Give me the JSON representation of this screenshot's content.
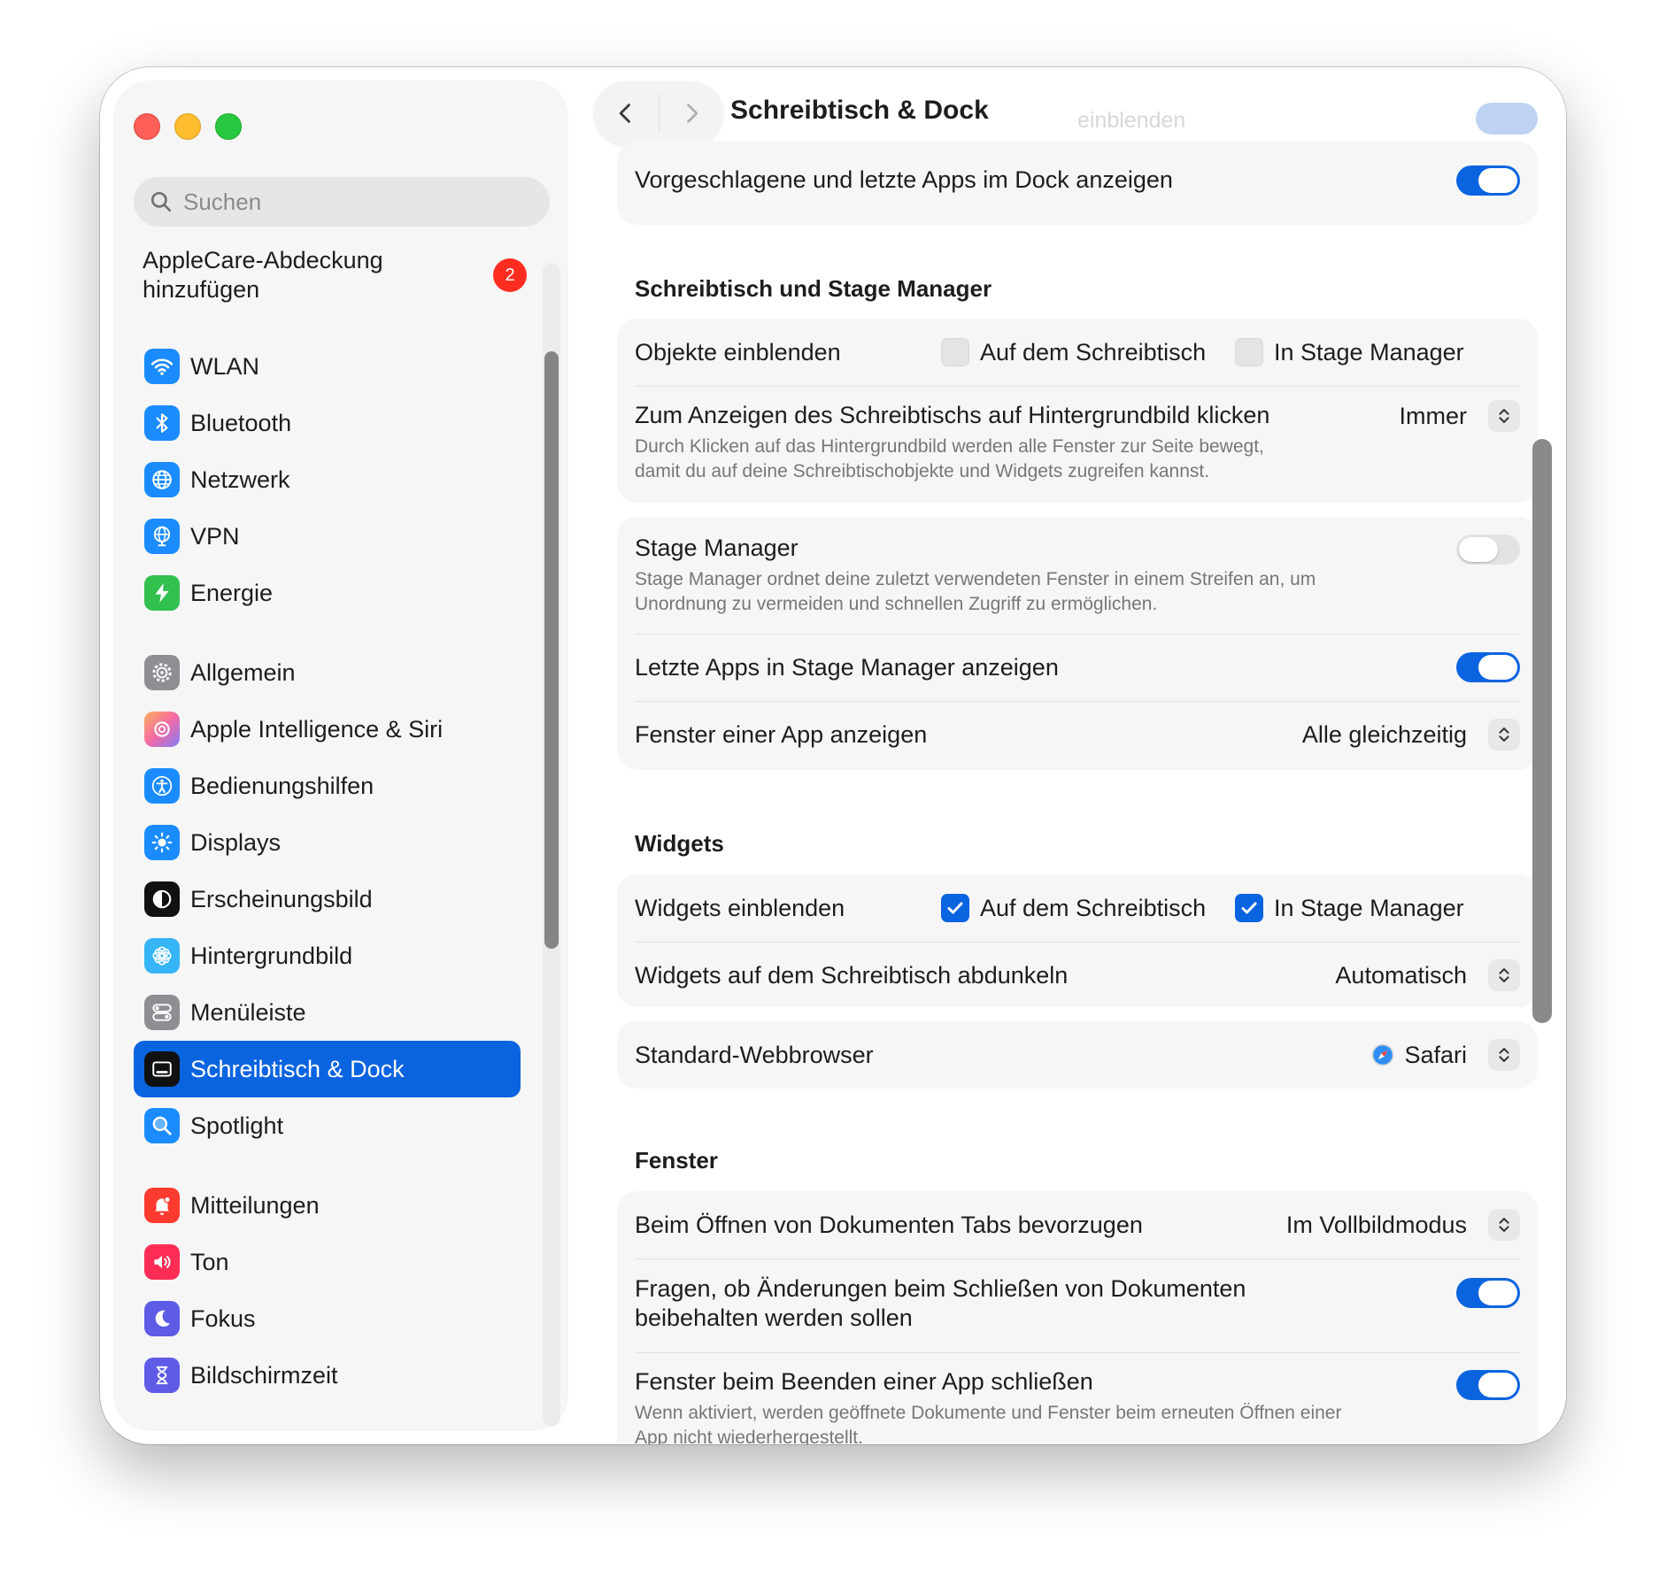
{
  "window": {
    "title": "Schreibtisch & Dock"
  },
  "sidebar": {
    "search_placeholder": "Suchen",
    "applecare": {
      "line1": "AppleCare-Abdeckung",
      "line2": "hinzufügen",
      "badge": "2"
    },
    "items": [
      {
        "label": "WLAN",
        "icon": "wifi-icon",
        "color": "#1a8cff"
      },
      {
        "label": "Bluetooth",
        "icon": "bluetooth-icon",
        "color": "#1a8cff"
      },
      {
        "label": "Netzwerk",
        "icon": "globe-icon",
        "color": "#1a8cff"
      },
      {
        "label": "VPN",
        "icon": "vpn-globe-icon",
        "color": "#1a8cff"
      },
      {
        "label": "Energie",
        "icon": "bolt-icon",
        "color": "#32c04f"
      },
      {
        "label": "Allgemein",
        "icon": "gear-icon",
        "color": "#8e8e93"
      },
      {
        "label": "Apple Intelligence & Siri",
        "icon": "apple-intelligence-icon",
        "color": "#f46aa6"
      },
      {
        "label": "Bedienungshilfen",
        "icon": "accessibility-icon",
        "color": "#1a8cff"
      },
      {
        "label": "Displays",
        "icon": "sun-icon",
        "color": "#1a8cff"
      },
      {
        "label": "Erscheinungsbild",
        "icon": "appearance-icon",
        "color": "#111111"
      },
      {
        "label": "Hintergrundbild",
        "icon": "flower-icon",
        "color": "#35b5f5"
      },
      {
        "label": "Menüleiste",
        "icon": "menubar-icon",
        "color": "#8e8e93"
      },
      {
        "label": "Schreibtisch & Dock",
        "icon": "dock-icon",
        "color": "#111111",
        "selected": true
      },
      {
        "label": "Spotlight",
        "icon": "magnifier-icon",
        "color": "#1a8cff"
      },
      {
        "label": "Mitteilungen",
        "icon": "bell-icon",
        "color": "#ff3b30"
      },
      {
        "label": "Ton",
        "icon": "speaker-icon",
        "color": "#ff2d55"
      },
      {
        "label": "Fokus",
        "icon": "moon-icon",
        "color": "#5e5ce6"
      },
      {
        "label": "Bildschirmzeit",
        "icon": "hourglass-icon",
        "color": "#5e5ce6"
      }
    ]
  },
  "toolbar": {
    "title": "Schreibtisch & Dock",
    "ghost_text": "einblenden"
  },
  "dock_card": {
    "suggested_label": "Vorgeschlagene und letzte Apps im Dock anzeigen",
    "suggested_on": true
  },
  "desktop_stage": {
    "title": "Schreibtisch und Stage Manager",
    "show_items": {
      "label": "Objekte einblenden",
      "opt1": "Auf dem Schreibtisch",
      "opt1_on": false,
      "opt2": "In Stage Manager",
      "opt2_on": false
    },
    "click_wallpaper": {
      "label": "Zum Anzeigen des Schreibtischs auf Hintergrundbild klicken",
      "value": "Immer",
      "desc1": "Durch Klicken auf das Hintergrundbild werden alle Fenster zur Seite bewegt,",
      "desc2": "damit du auf deine Schreibtischobjekte und Widgets zugreifen kannst."
    },
    "stage_manager": {
      "label": "Stage Manager",
      "on": false,
      "desc1": "Stage Manager ordnet deine zuletzt verwendeten Fenster in einem Streifen an, um",
      "desc2": "Unordnung zu vermeiden und schnellen Zugriff zu ermöglichen."
    },
    "recent_apps": {
      "label": "Letzte Apps in Stage Manager anzeigen",
      "on": true
    },
    "app_windows": {
      "label": "Fenster einer App anzeigen",
      "value": "Alle gleichzeitig"
    }
  },
  "widgets": {
    "title": "Widgets",
    "show": {
      "label": "Widgets einblenden",
      "opt1": "Auf dem Schreibtisch",
      "opt1_on": true,
      "opt2": "In Stage Manager",
      "opt2_on": true
    },
    "dim": {
      "label": "Widgets auf dem Schreibtisch abdunkeln",
      "value": "Automatisch"
    }
  },
  "browser": {
    "label": "Standard-Webbrowser",
    "value": "Safari"
  },
  "windows": {
    "title": "Fenster",
    "tabs": {
      "label": "Beim Öffnen von Dokumenten Tabs bevorzugen",
      "value": "Im Vollbildmodus"
    },
    "ask_keep": {
      "line1": "Fragen, ob Änderungen beim Schließen von Dokumenten",
      "line2": "beibehalten werden sollen",
      "on": true
    },
    "close_windows": {
      "label": "Fenster beim Beenden einer App schließen",
      "on": true,
      "desc1": "Wenn aktiviert, werden geöffnete Dokumente und Fenster beim erneuten Öffnen einer",
      "desc2": "App nicht wiederhergestellt."
    }
  },
  "colors": {
    "accent": "#0a64e0",
    "badge": "#ff2d20",
    "card": "#f6f6f6",
    "sidebar": "#f6f6f6"
  }
}
